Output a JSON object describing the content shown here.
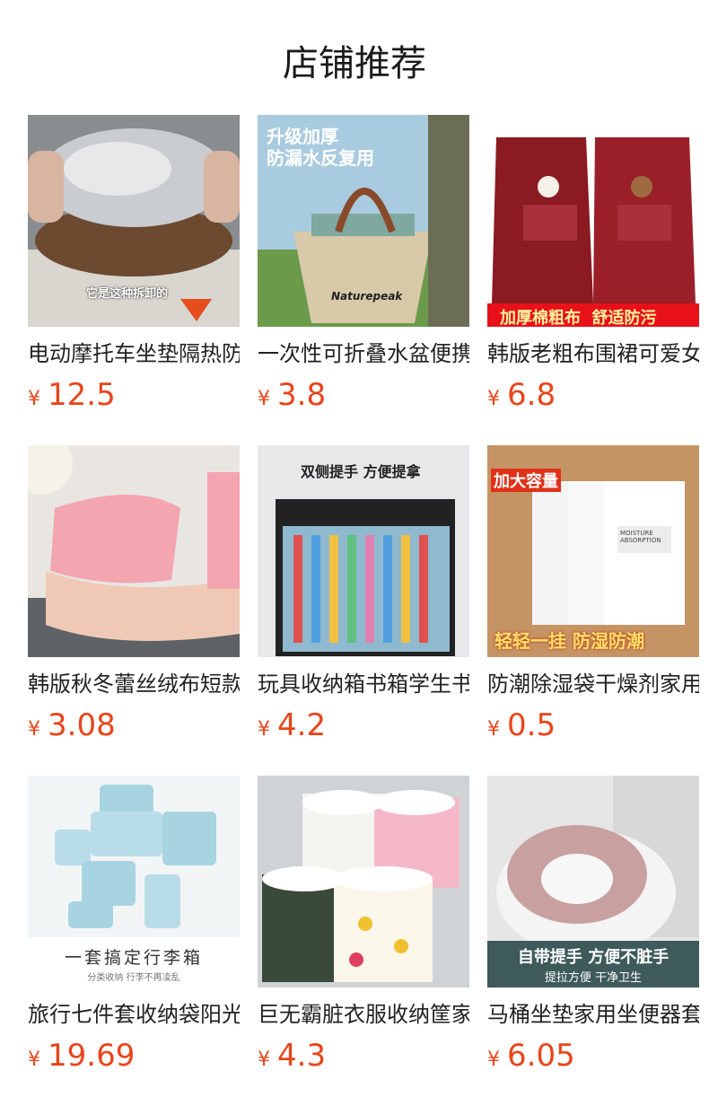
{
  "page": {
    "title": "店铺推荐"
  },
  "currency": "¥",
  "products": [
    {
      "name": "电动摩托车坐垫隔热防晒",
      "price": "12.5",
      "overlay": [
        "它是这种拆卸的"
      ]
    },
    {
      "name": "一次性可折叠水盆便携",
      "price": "3.8",
      "overlay": [
        "升级加厚",
        "防漏水反复用",
        "Naturepeak"
      ]
    },
    {
      "name": "韩版老粗布围裙可爱女",
      "price": "6.8",
      "overlay": [
        "加厚棉粗布  舒适防污"
      ]
    },
    {
      "name": "韩版秋冬蕾丝绒布短款袖套",
      "price": "3.08",
      "overlay": []
    },
    {
      "name": "玩具收纳箱书箱学生书本",
      "price": "4.2",
      "overlay": [
        "双侧提手 方便提拿"
      ]
    },
    {
      "name": "防潮除湿袋干燥剂家用",
      "price": "0.5",
      "overlay": [
        "加大容量",
        "轻轻一挂 防湿防潮",
        "MOISTURE ABSORPTION"
      ]
    },
    {
      "name": "旅行七件套收纳袋阳光",
      "price": "19.69",
      "overlay": [
        "一套搞定行李箱",
        "分类收纳 行李不再凌乱"
      ]
    },
    {
      "name": "巨无霸脏衣服收纳筐家用",
      "price": "4.3",
      "overlay": []
    },
    {
      "name": "马桶坐垫家用坐便器套",
      "price": "6.05",
      "overlay": [
        "自带提手 方便不脏手",
        "提拉方便 干净卫生"
      ]
    }
  ]
}
